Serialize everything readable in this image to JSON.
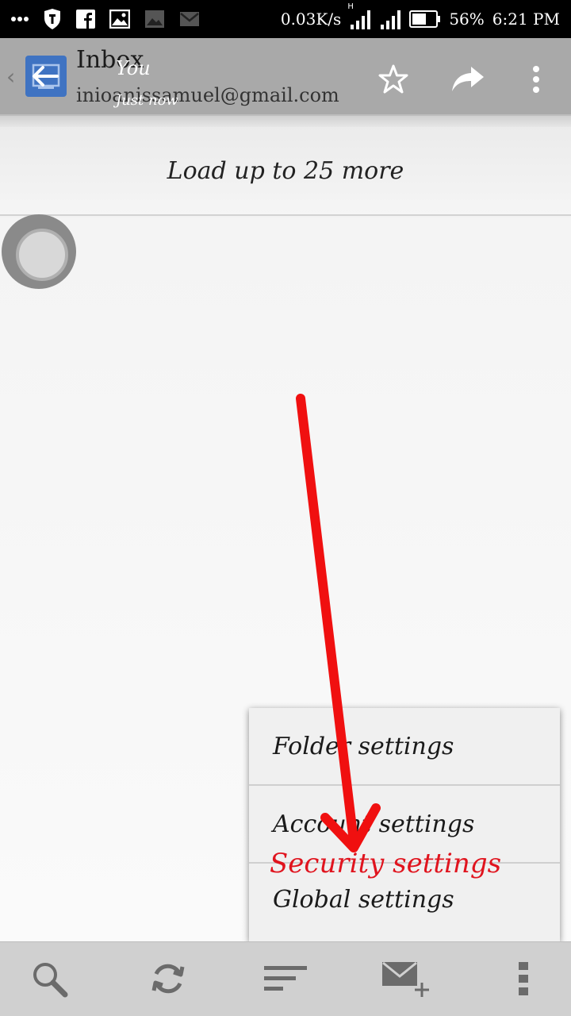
{
  "status_bar": {
    "net_speed": "0.03K/s",
    "network_type": "H",
    "battery": "56%",
    "time": "6:21 PM",
    "icons": [
      "more-dots-icon",
      "shield-icon",
      "facebook-icon",
      "image-icon",
      "gallery-icon",
      "mail-icon",
      "signal-icon",
      "signal-icon",
      "battery-icon"
    ]
  },
  "app_bar": {
    "title": "Inbox",
    "account": "inioanissamuel@gmail.com",
    "overlay_sender": "You",
    "overlay_time": "Just now",
    "icons": [
      "chevron-left-icon",
      "back-arrow-icon",
      "star-icon",
      "forward-icon",
      "overflow-menu-icon"
    ]
  },
  "list": {
    "load_more": "Load up to 25 more"
  },
  "menu": {
    "items": [
      {
        "label": "Folder settings"
      },
      {
        "label": "Account settings"
      },
      {
        "label": "Global settings"
      }
    ],
    "annotation": "Security settings",
    "annotation_color": "#e0141e"
  },
  "bottom_bar": {
    "icons": [
      "search-icon",
      "refresh-icon",
      "sort-icon",
      "compose-icon",
      "overflow-menu-icon"
    ]
  }
}
